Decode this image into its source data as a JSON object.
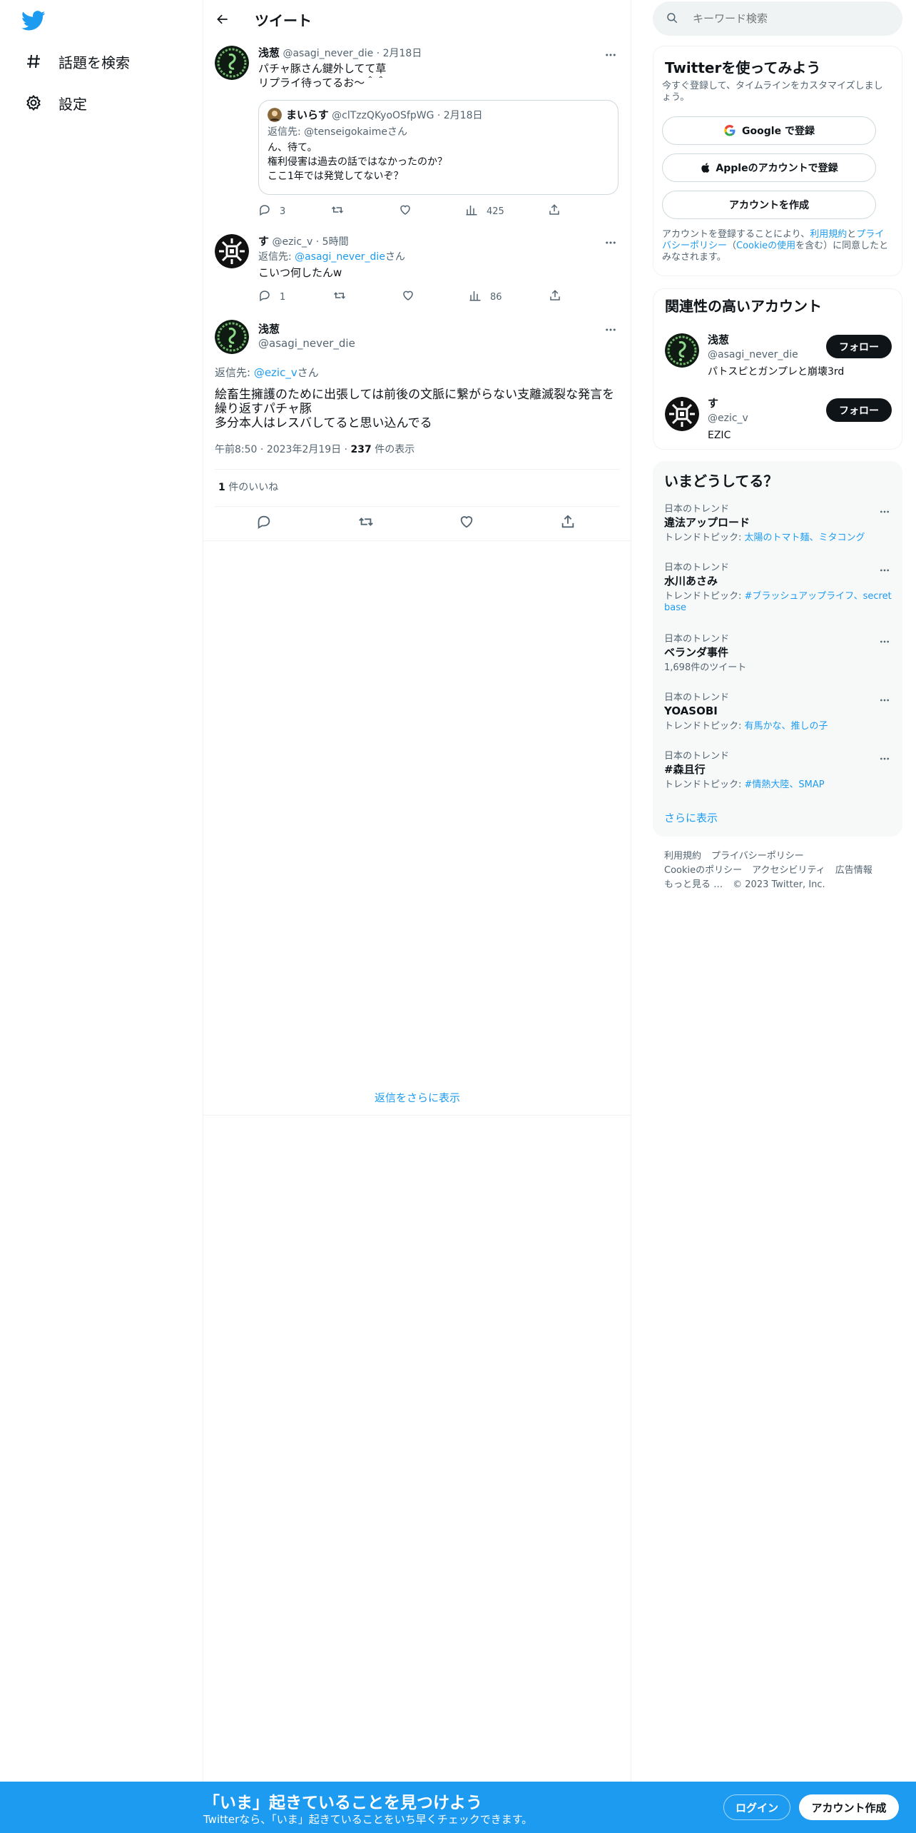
{
  "nav": {
    "explore_label": "話題を検索",
    "settings_label": "設定"
  },
  "header": {
    "title": "ツイート"
  },
  "tweet1": {
    "name": "浅葱",
    "handle": "@asagi_never_die",
    "dot": "·",
    "date": "2月18日",
    "lines": [
      "パチャ豚さん鍵外してて草",
      "リプライ待ってるお〜＾＾"
    ],
    "quote": {
      "name": "まいらす",
      "handle": "@clTzzQKyoOSfpWG",
      "dot": "·",
      "date": "2月18日",
      "reply_prefix": "返信先: ",
      "reply_to": "@tenseigokaime",
      "reply_suffix": "さん",
      "lines": [
        "ん、待て。",
        "権利侵害は過去の話ではなかったのか？",
        "ここ1年では発覚してないぞ？"
      ]
    },
    "stats": {
      "replies": "3",
      "views": "425"
    }
  },
  "tweet2": {
    "name": "す",
    "handle": "@ezic_v",
    "dot": "·",
    "time": "5時間",
    "reply_prefix": "返信先: ",
    "reply_to": "@asagi_never_die",
    "reply_suffix": "さん",
    "text": "こいつ何したんw",
    "stats": {
      "replies": "1",
      "views": "86"
    }
  },
  "main_tweet": {
    "name": "浅葱",
    "handle": "@asagi_never_die",
    "reply_prefix": "返信先: ",
    "reply_to": "@ezic_v",
    "reply_suffix": "さん",
    "lines": [
      "絵畜生擁護のために出張しては前後の文脈に繋がらない支離滅裂な発言を",
      "繰り返すパチャ豚",
      "多分本人はレスバしてると思い込んでる"
    ],
    "time": "午前8:50",
    "sep": "·",
    "date": "2023年2月19日",
    "views_count": "237",
    "views_label": " 件の表示",
    "likes_count": "1",
    "likes_label": " 件のいいね"
  },
  "show_more_replies": "返信をさらに表示",
  "search": {
    "placeholder": "キーワード検索"
  },
  "signup_card": {
    "title": "Twitterを使ってみよう",
    "subtitle": "今すぐ登録して、タイムラインをカスタマイズしましょう。",
    "google": "Google で登録",
    "apple": "Appleのアカウントで登録",
    "create": "アカウントを作成",
    "terms_a": "アカウントを登録することにより、",
    "terms_link1": "利用規約",
    "terms_b": "と",
    "terms_link2": "プライバシーポリシー",
    "terms_c": "（",
    "terms_link3": "Cookieの使用",
    "terms_d": "を含む）に同意したとみなされます。"
  },
  "related": {
    "title": "関連性の高いアカウント",
    "follow_label": "フォロー",
    "accounts": [
      {
        "name": "浅葱",
        "handle": "@asagi_never_die",
        "bio": "パトスピとガンプレと崩壊3rd"
      },
      {
        "name": "す",
        "handle": "@ezic_v",
        "bio": "EZIC"
      }
    ]
  },
  "trends": {
    "title": "いまどうしてる？",
    "items": [
      {
        "context": "日本のトレンド",
        "name": "違法アップロード",
        "meta_prefix": "トレンドトピック: ",
        "meta_link": "太陽のトマト麺、ミタコング"
      },
      {
        "context": "日本のトレンド",
        "name": "水川あさみ",
        "meta_prefix": "トレンドトピック: ",
        "meta_link": "#ブラッシュアップライフ、secret base"
      },
      {
        "context": "日本のトレンド",
        "name": "ベランダ事件",
        "meta_prefix": "1,698件のツイート",
        "meta_link": ""
      },
      {
        "context": "日本のトレンド",
        "name": "YOASOBI",
        "meta_prefix": "トレンドトピック: ",
        "meta_link": "有馬かな、推しの子"
      },
      {
        "context": "日本のトレンド",
        "name": "#森且行",
        "meta_prefix": "トレンドトピック: ",
        "meta_link": "#情熱大陸、SMAP"
      }
    ],
    "show_more": "さらに表示"
  },
  "footer": {
    "terms": "利用規約",
    "privacy": "プライバシーポリシー",
    "cookie": "Cookieのポリシー",
    "accessibility": "アクセシビリティ",
    "ads": "広告情報",
    "more": "もっと見る …",
    "copyright": "© 2023 Twitter, Inc."
  },
  "bottom_bar": {
    "title": "「いま」起きていることを見つけよう",
    "subtitle": "Twitterなら、「いま」起きていることをいち早くチェックできます。",
    "login": "ログイン",
    "signup": "アカウント作成"
  },
  "colors": {
    "accent": "#1d9bf0",
    "text": "#0f1419",
    "secondary": "#536471",
    "border": "#eff3f4"
  }
}
